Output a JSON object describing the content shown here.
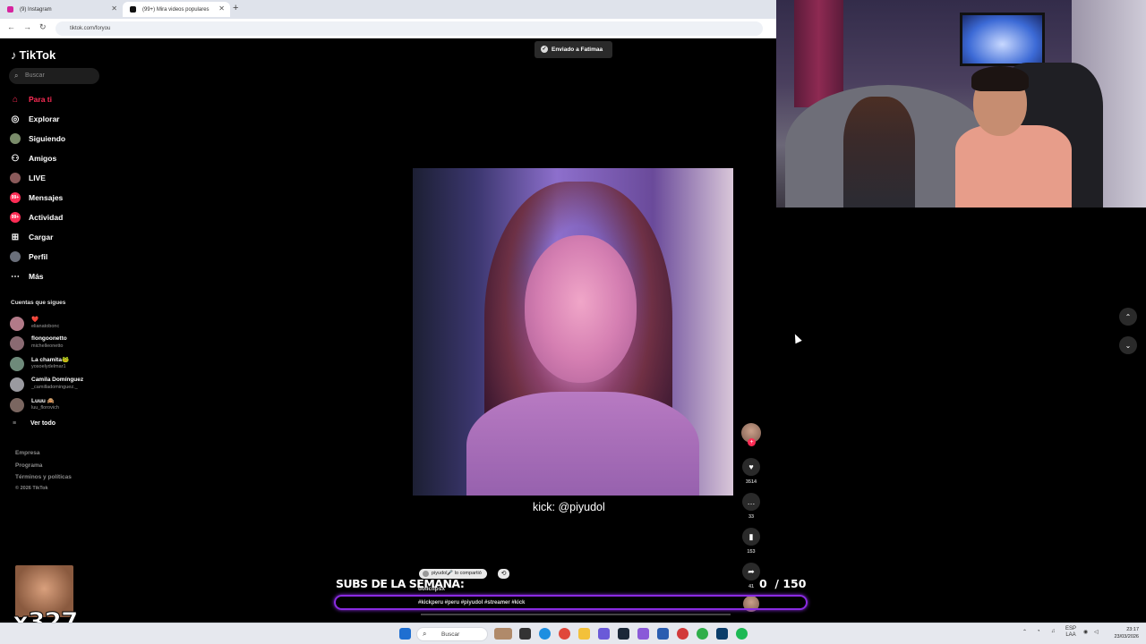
{
  "browser": {
    "tabs": [
      {
        "title": "(9) Instagram",
        "active": false
      },
      {
        "title": "(99+) Mira videos populares",
        "active": true
      }
    ],
    "url": "tiktok.com/foryou"
  },
  "tiktok": {
    "logo": "TikTok",
    "search_placeholder": "Buscar",
    "nav": [
      {
        "label": "Para ti",
        "icon": "home-icon",
        "active": true
      },
      {
        "label": "Explorar",
        "icon": "compass-icon"
      },
      {
        "label": "Siguiendo",
        "icon": "following-avatar-icon"
      },
      {
        "label": "Amigos",
        "icon": "friends-icon"
      },
      {
        "label": "LIVE",
        "icon": "live-icon"
      },
      {
        "label": "Mensajes",
        "icon": "message-icon",
        "badge": "99+"
      },
      {
        "label": "Actividad",
        "icon": "activity-icon",
        "badge": "99+"
      },
      {
        "label": "Cargar",
        "icon": "upload-icon"
      },
      {
        "label": "Perfil",
        "icon": "profile-avatar-icon"
      },
      {
        "label": "Más",
        "icon": "more-icon"
      }
    ],
    "following_title": "Cuentas que sigues",
    "following": [
      {
        "name": "❤️",
        "handle": "elianatobonc"
      },
      {
        "name": "flongoonetto",
        "handle": "michelleonetto"
      },
      {
        "name": "La chamita🐸",
        "handle": "yosoelydelmar1"
      },
      {
        "name": "Camila Domínguez",
        "handle": "_camilladominguez._"
      },
      {
        "name": "Luuu 🙈",
        "handle": "luu_florovich"
      }
    ],
    "see_all": "Ver todo",
    "footer": [
      "Empresa",
      "Programa",
      "Términos y políticas",
      "© 2026 TikTok"
    ],
    "toast": "Enviado a Fatimaa",
    "video_caption": "kick: @piyudol",
    "actions": {
      "likes": "3514",
      "comments": "33",
      "saves": "153",
      "shares": "41"
    },
    "shared_by": "piyudol🎤 lo compartió",
    "username": "dollclipsx",
    "hashtags": "#kickperu #peru #piyudol #streamer #kick"
  },
  "overlay": {
    "subs_label": "SUBS DE LA SEMANA:",
    "subs_count": "0",
    "subs_goal": "/ 150",
    "multiplier": "x327"
  },
  "taskbar": {
    "search": "Buscar",
    "lang": "ESP",
    "layout": "LAA",
    "time": "23:17",
    "date": "23/03/2026"
  },
  "colors": {
    "accent": "#fe2c55",
    "overlay_bar": "#8a2be2"
  }
}
